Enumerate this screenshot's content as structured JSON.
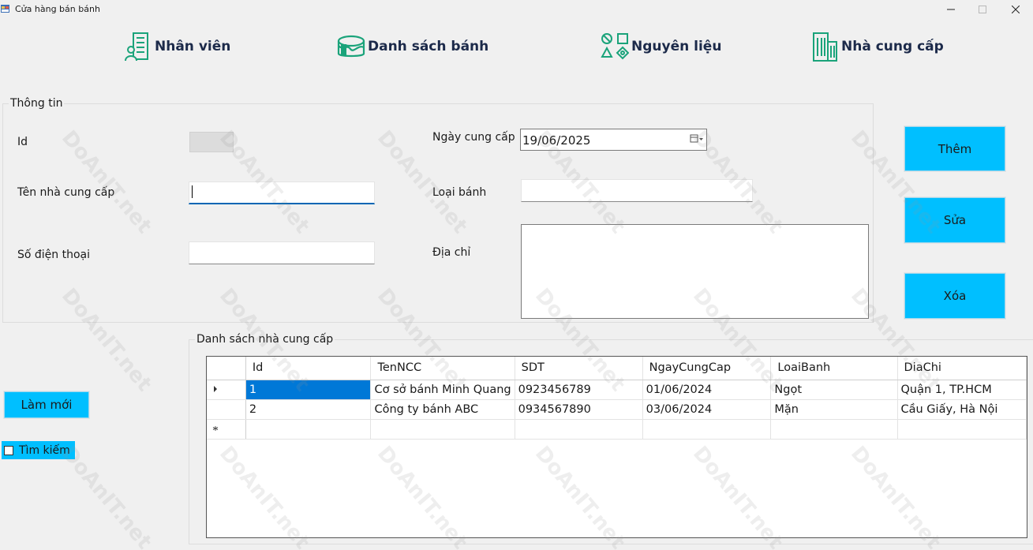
{
  "window": {
    "title": "Cửa hàng bán bánh",
    "controls": [
      "minimize",
      "maximize",
      "close"
    ]
  },
  "nav": {
    "items": [
      {
        "label": "Nhân viên",
        "icon": "employee-building-icon"
      },
      {
        "label": "Danh sách bánh",
        "icon": "cake-icon"
      },
      {
        "label": "Nguyên liệu",
        "icon": "shapes-icon"
      },
      {
        "label": "Nhà cung cấp",
        "icon": "building-icon"
      }
    ]
  },
  "info": {
    "title": "Thông tin",
    "id_label": "Id",
    "id_value": "",
    "name_label": "Tên nhà cung cấp",
    "name_value": "",
    "phone_label": "Số điện thoại",
    "phone_value": "",
    "date_label": "Ngày cung cấp",
    "date_value": "19/06/2025",
    "type_label": "Loại bánh",
    "type_value": "",
    "address_label": "Địa chỉ",
    "address_value": ""
  },
  "actions": {
    "add": "Thêm",
    "edit": "Sửa",
    "delete": "Xóa",
    "refresh": "Làm mới",
    "search": "Tìm kiếm"
  },
  "list": {
    "title": "Danh sách nhà cung cấp",
    "columns": [
      "Id",
      "TenNCC",
      "SDT",
      "NgayCungCap",
      "LoaiBanh",
      "DiaChi"
    ],
    "rows": [
      [
        "1",
        "Cơ sở bánh Minh Quang",
        "0923456789",
        "01/06/2024",
        "Ngọt",
        "Quận 1, TP.HCM"
      ],
      [
        "2",
        "Công ty bánh ABC",
        "0934567890",
        "03/06/2024",
        "Mặn",
        "Cầu Giấy, Hà Nội"
      ]
    ]
  },
  "watermark": "DoAnIT.net",
  "colors": {
    "accent_button": "#00bfff",
    "selection": "#0078d7",
    "nav_icon": "#1aa37a"
  }
}
